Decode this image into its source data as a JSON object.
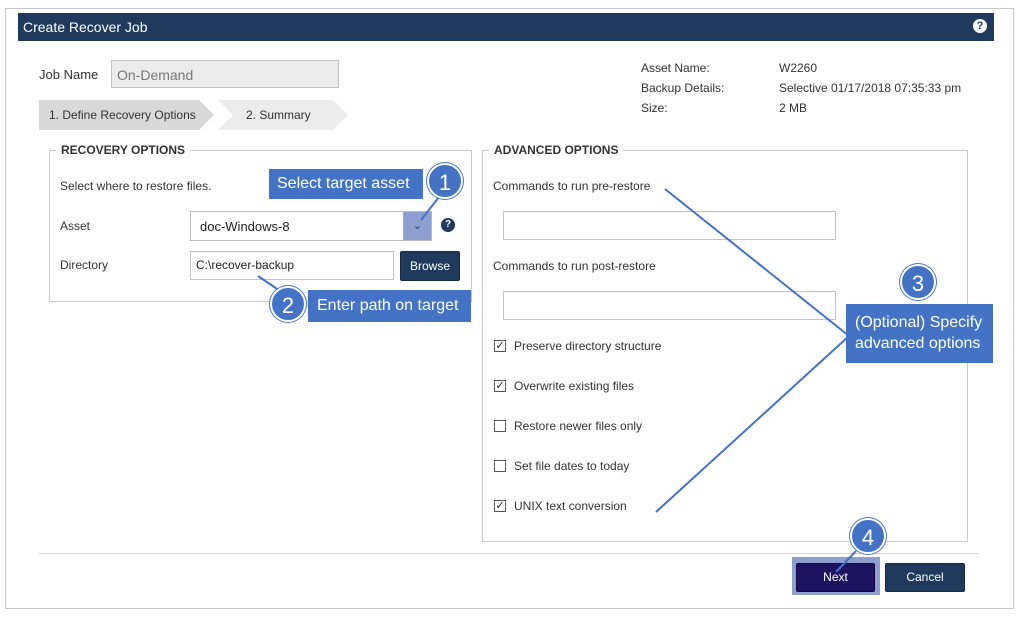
{
  "window": {
    "title": "Create Recover Job",
    "help_glyph": "?"
  },
  "job": {
    "label": "Job Name",
    "value": "On-Demand"
  },
  "steps": [
    {
      "label": "1. Define Recovery Options",
      "active": true
    },
    {
      "label": "2. Summary",
      "active": false
    }
  ],
  "meta": [
    {
      "label": "Asset Name:",
      "value": "W2260"
    },
    {
      "label": "Backup Details:",
      "value": "Selective 01/17/2018 07:35:33 pm"
    },
    {
      "label": "Size:",
      "value": "2 MB"
    }
  ],
  "recovery": {
    "legend": "RECOVERY OPTIONS",
    "intro": "Select where to restore files.",
    "asset_label": "Asset",
    "asset_value": "doc-Windows-8",
    "help_glyph": "?",
    "directory_label": "Directory",
    "directory_value": "C:\\recover-backup",
    "browse_label": "Browse"
  },
  "advanced": {
    "legend": "ADVANCED OPTIONS",
    "pre_label": "Commands to run pre-restore",
    "pre_value": "",
    "post_label": "Commands to run post-restore",
    "post_value": "",
    "options": [
      {
        "label": "Preserve directory structure",
        "checked": true
      },
      {
        "label": "Overwrite existing files",
        "checked": true
      },
      {
        "label": "Restore newer files only",
        "checked": false
      },
      {
        "label": "Set file dates to today",
        "checked": false
      },
      {
        "label": "UNIX text conversion",
        "checked": true
      }
    ]
  },
  "footer": {
    "next_label": "Next",
    "cancel_label": "Cancel"
  },
  "callouts": {
    "c1": {
      "number": "1",
      "text": "Select target asset"
    },
    "c2": {
      "number": "2",
      "text": "Enter path on target"
    },
    "c3": {
      "number": "3",
      "line1": "(Optional) Specify",
      "line2": "advanced options"
    },
    "c4": {
      "number": "4"
    }
  },
  "colors": {
    "header": "#1f3a5c",
    "callout": "#4472c4",
    "highlight": "#8d9fce"
  },
  "icons": {
    "help": "question-circle-icon",
    "dropdown": "chevron-down-icon",
    "check": "checkmark-icon"
  }
}
